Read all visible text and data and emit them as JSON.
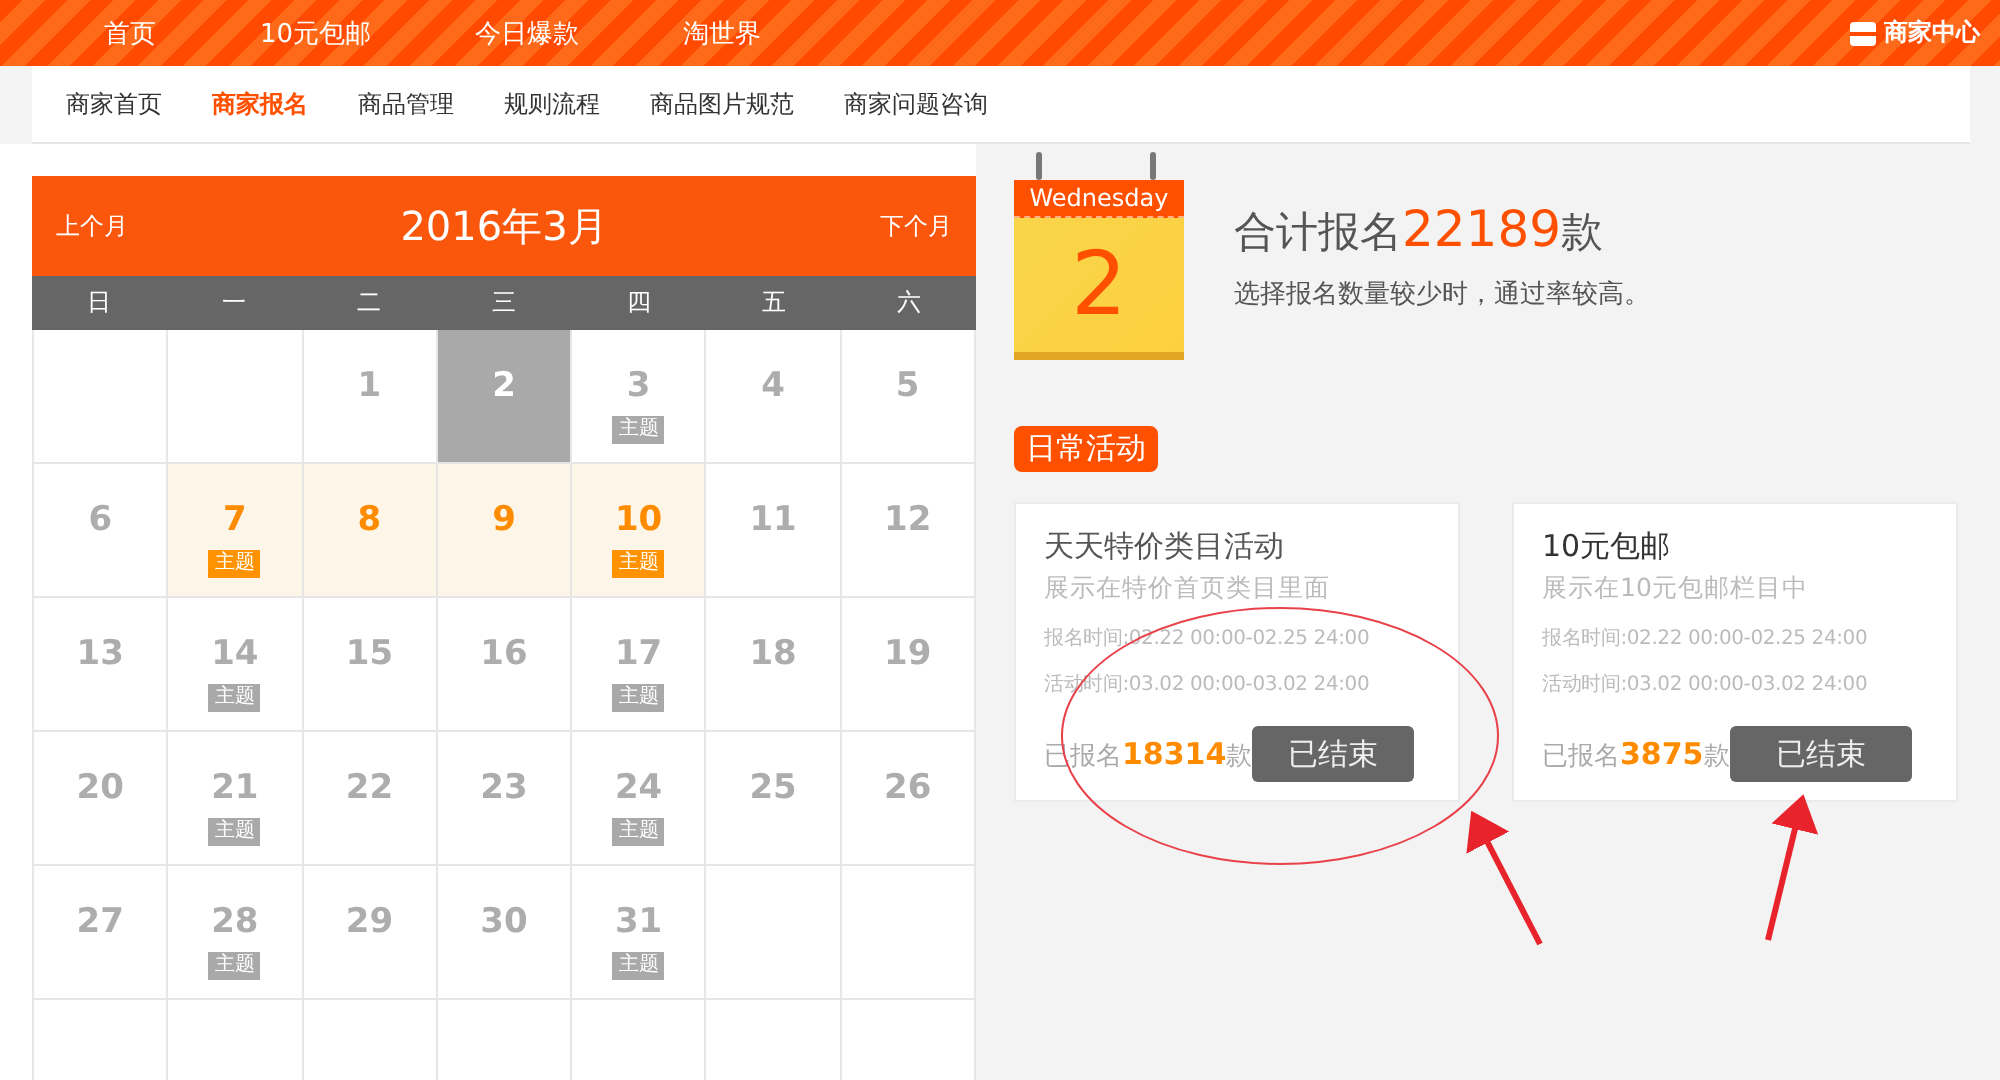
{
  "top_nav": {
    "links": [
      "首页",
      "10元包邮",
      "今日爆款",
      "淘世界"
    ],
    "account": "商家中心"
  },
  "sub_nav": [
    {
      "label": "商家首页",
      "selected": false
    },
    {
      "label": "商家报名",
      "selected": true
    },
    {
      "label": "商品管理",
      "selected": false
    },
    {
      "label": "规则流程",
      "selected": false
    },
    {
      "label": "商品图片规范",
      "selected": false
    },
    {
      "label": "商家问题咨询",
      "selected": false
    }
  ],
  "calendar": {
    "prev": "上个月",
    "title": "2016年3月",
    "next": "下个月",
    "weekdays": [
      "日",
      "一",
      "二",
      "三",
      "四",
      "五",
      "六"
    ],
    "cells": [
      {
        "kind": "blank"
      },
      {
        "kind": "blank"
      },
      {
        "kind": "day",
        "number": "1",
        "today": false,
        "available": false
      },
      {
        "kind": "day",
        "number": "2",
        "today": true,
        "available": false
      },
      {
        "kind": "day",
        "number": "3",
        "today": false,
        "available": false,
        "tag": "主题"
      },
      {
        "kind": "day",
        "number": "4",
        "today": false,
        "available": false
      },
      {
        "kind": "day",
        "number": "5",
        "today": false,
        "available": false
      },
      {
        "kind": "day",
        "number": "6",
        "today": false,
        "available": false
      },
      {
        "kind": "day",
        "number": "7",
        "today": false,
        "available": true,
        "tag": "主题"
      },
      {
        "kind": "day",
        "number": "8",
        "today": false,
        "available": true
      },
      {
        "kind": "day",
        "number": "9",
        "today": false,
        "available": true
      },
      {
        "kind": "day",
        "number": "10",
        "today": false,
        "available": true,
        "tag": "主题"
      },
      {
        "kind": "day",
        "number": "11",
        "today": false,
        "available": false
      },
      {
        "kind": "day",
        "number": "12",
        "today": false,
        "available": false
      },
      {
        "kind": "day",
        "number": "13",
        "today": false,
        "available": false
      },
      {
        "kind": "day",
        "number": "14",
        "today": false,
        "available": false,
        "tag": "主题"
      },
      {
        "kind": "day",
        "number": "15",
        "today": false,
        "available": false
      },
      {
        "kind": "day",
        "number": "16",
        "today": false,
        "available": false
      },
      {
        "kind": "day",
        "number": "17",
        "today": false,
        "available": false,
        "tag": "主题"
      },
      {
        "kind": "day",
        "number": "18",
        "today": false,
        "available": false
      },
      {
        "kind": "day",
        "number": "19",
        "today": false,
        "available": false
      },
      {
        "kind": "day",
        "number": "20",
        "today": false,
        "available": false
      },
      {
        "kind": "day",
        "number": "21",
        "today": false,
        "available": false,
        "tag": "主题"
      },
      {
        "kind": "day",
        "number": "22",
        "today": false,
        "available": false
      },
      {
        "kind": "day",
        "number": "23",
        "today": false,
        "available": false
      },
      {
        "kind": "day",
        "number": "24",
        "today": false,
        "available": false,
        "tag": "主题"
      },
      {
        "kind": "day",
        "number": "25",
        "today": false,
        "available": false
      },
      {
        "kind": "day",
        "number": "26",
        "today": false,
        "available": false
      },
      {
        "kind": "day",
        "number": "27",
        "today": false,
        "available": false
      },
      {
        "kind": "day",
        "number": "28",
        "today": false,
        "available": false,
        "tag": "主题"
      },
      {
        "kind": "day",
        "number": "29",
        "today": false,
        "available": false
      },
      {
        "kind": "day",
        "number": "30",
        "today": false,
        "available": false
      },
      {
        "kind": "day",
        "number": "31",
        "today": false,
        "available": false,
        "tag": "主题"
      },
      {
        "kind": "blank"
      },
      {
        "kind": "blank"
      },
      {
        "kind": "blank"
      },
      {
        "kind": "blank"
      },
      {
        "kind": "blank"
      },
      {
        "kind": "blank"
      },
      {
        "kind": "blank"
      },
      {
        "kind": "blank"
      },
      {
        "kind": "blank"
      }
    ]
  },
  "today_card": {
    "weekday": "Wednesday",
    "day": "2"
  },
  "summary": {
    "prefix": "合计报名",
    "count": "22189",
    "suffix": "款",
    "note": "选择报名数量较少时，通过率较高。"
  },
  "section_label": "日常活动",
  "activities": [
    {
      "title": "天天特价类目活动",
      "desc": "展示在特价首页类目里面",
      "signup_time": "报名时间:02.22 00:00-02.25 24:00",
      "activity_time": "活动时间:03.02 00:00-03.02 24:00",
      "registered_prefix": "已报名",
      "registered_count": "18314",
      "registered_suffix": "款",
      "button": "已结束",
      "ended": true
    },
    {
      "title": "10元包邮",
      "desc": "展示在10元包邮栏目中",
      "signup_time": "报名时间:02.22 00:00-02.25 24:00",
      "activity_time": "活动时间:03.02 00:00-03.02 24:00",
      "registered_prefix": "已报名",
      "registered_count": "3875",
      "registered_suffix": "款",
      "button": "已结束",
      "ended": true
    }
  ]
}
